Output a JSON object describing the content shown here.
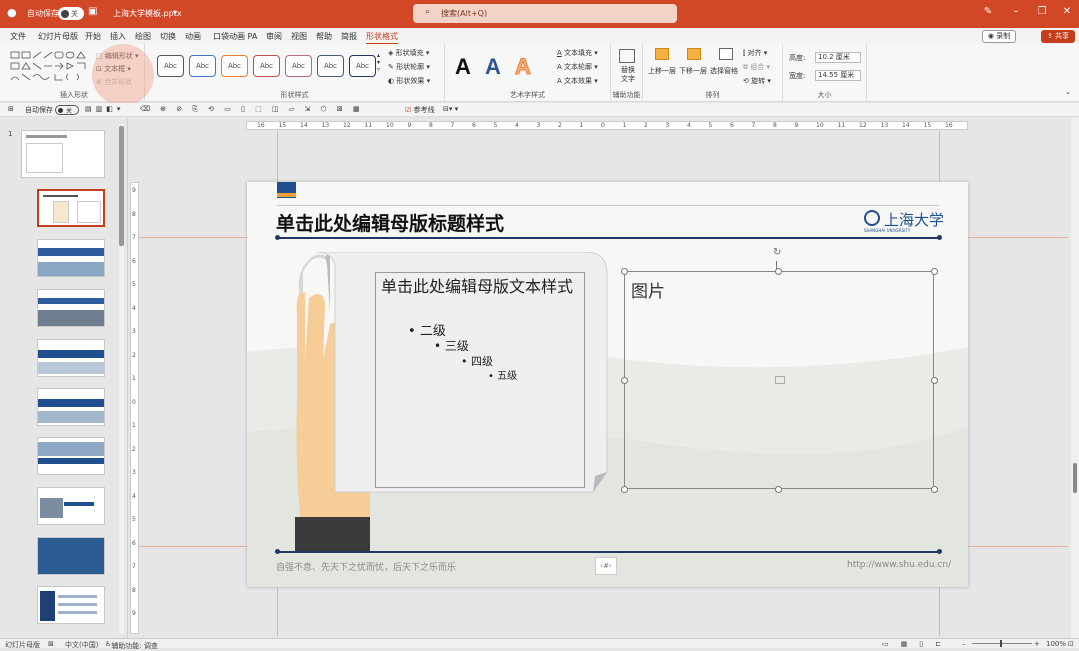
{
  "titlebar": {
    "autosave_label": "自动保存",
    "autosave_state": "关",
    "filename": "上海大学模板.pptx",
    "search_placeholder": "搜索(Alt+Q)"
  },
  "tabs": [
    "文件",
    "幻灯片母版",
    "开始",
    "插入",
    "绘图",
    "切换",
    "动画",
    "口袋动画 PA",
    "审阅",
    "视图",
    "帮助",
    "简报",
    "形状格式"
  ],
  "active_tab": "形状格式",
  "record_label": "录制",
  "share_label": "共享",
  "ribbon": {
    "insert_shapes": {
      "label": "插入形状",
      "edit_shape": "编辑形状",
      "text_box": "文本框",
      "merge_shapes": "合并形状"
    },
    "shape_styles": {
      "label": "形状样式",
      "sample": "Abc",
      "fill": "形状填充",
      "outline": "形状轮廓",
      "effects": "形状效果"
    },
    "wordart": {
      "label": "艺术字样式",
      "text_fill": "文本填充",
      "text_outline": "文本轮廓",
      "text_effects": "文本效果"
    },
    "accessibility": {
      "label": "辅助功能",
      "alt_text": "替换文字"
    },
    "arrange": {
      "label": "排列",
      "bring_forward": "上移一层",
      "send_backward": "下移一层",
      "selection_pane": "选择窗格",
      "align": "对齐",
      "group": "组合",
      "rotate": "旋转"
    },
    "size": {
      "label": "大小",
      "height_label": "高度:",
      "height_value": "10.2 厘米",
      "width_label": "宽度:",
      "width_value": "14.55 厘米"
    }
  },
  "qat": {
    "autosave_label": "自动保存",
    "autosave_state": "关",
    "reference_line": "参考线"
  },
  "ruler_h": [
    "16",
    "15",
    "14",
    "13",
    "12",
    "11",
    "10",
    "9",
    "8",
    "7",
    "6",
    "5",
    "4",
    "3",
    "2",
    "1",
    "0",
    "1",
    "2",
    "3",
    "4",
    "5",
    "6",
    "7",
    "8",
    "9",
    "10",
    "11",
    "12",
    "13",
    "14",
    "15",
    "16"
  ],
  "ruler_v": [
    "9",
    "8",
    "7",
    "6",
    "5",
    "4",
    "3",
    "2",
    "1",
    "0",
    "1",
    "2",
    "3",
    "4",
    "5",
    "6",
    "7",
    "8",
    "9"
  ],
  "thumbnail_number": "1",
  "slide": {
    "title": "单击此处编辑母版标题样式",
    "logo_text": "上海大学",
    "logo_sub": "SHANGHAI UNIVERSITY",
    "text_levels": [
      "单击此处编辑母版文本样式",
      "二级",
      "三级",
      "四级",
      "五级"
    ],
    "picture_label": "图片",
    "footer_left": "自强不息、先天下之忧而忧，后天下之乐而乐",
    "footer_right": "http://www.shu.edu.cn/",
    "slide_number": "‹#›"
  },
  "statusbar": {
    "view": "幻灯片母版",
    "language": "中文(中国)",
    "accessibility": "辅助功能: 调查",
    "zoom": "100%"
  },
  "colors": {
    "accent": "#c43e1c",
    "titlebar": "#d24726",
    "slide_line": "#1f3864"
  }
}
